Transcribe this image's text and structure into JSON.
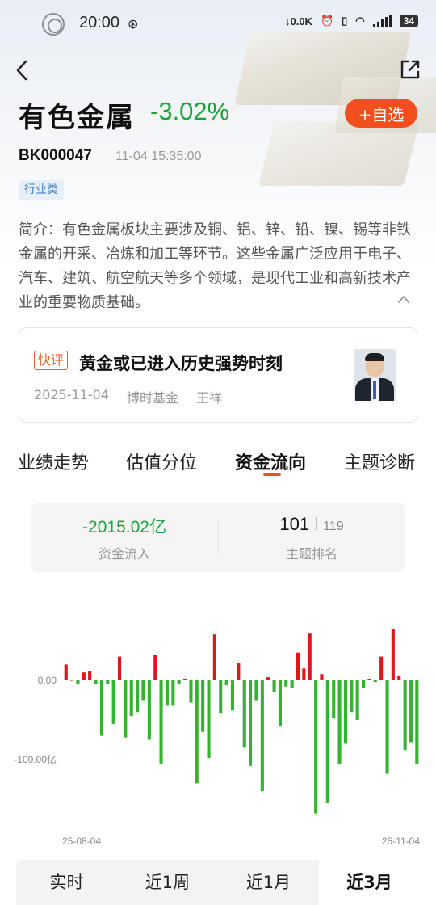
{
  "status_bar": {
    "time": "20:00",
    "net_speed": "0.0K",
    "battery": "34"
  },
  "header": {
    "title": "有色金属",
    "change": "-3.02%",
    "add_label": "+自选",
    "code": "BK000047",
    "timestamp": "11-04 15:35:00",
    "tag": "行业类"
  },
  "intro": "简介：有色金属板块主要涉及铜、铝、锌、铅、镍、锡等非铁金属的开采、冶炼和加工等环节。这些金属广泛应用于电子、汽车、建筑、航空航天等多个领域，是现代工业和高新技术产业的重要物质基础。",
  "news_card": {
    "tag": "快评",
    "title": "黄金或已进入历史强势时刻",
    "date": "2025-11-04",
    "source": "博时基金",
    "author": "王祥"
  },
  "tabs": [
    "业绩走势",
    "估值分位",
    "资金流向",
    "主题诊断"
  ],
  "active_tab": "资金流向",
  "stats": {
    "inflow_value": "-2015.02亿",
    "inflow_label": "资金流入",
    "rank": "101",
    "rank_total": "119",
    "rank_label": "主题排名"
  },
  "periods": [
    "实时",
    "近1周",
    "近1月",
    "近3月"
  ],
  "active_period": "近3月",
  "colors": {
    "positive": "#e0161c",
    "negative": "#33b32f",
    "accent": "#f24e1e"
  },
  "chart_data": {
    "type": "bar",
    "x_start_label": "25-08-04",
    "x_end_label": "25-11-04",
    "y_ticks": [
      "0.00",
      "-100.00亿"
    ],
    "ylim": [
      -170,
      60
    ],
    "values": [
      20,
      0,
      -5,
      10,
      12,
      -5,
      -70,
      -5,
      -55,
      30,
      -72,
      -45,
      -40,
      -25,
      -75,
      32,
      -105,
      -32,
      -32,
      -4,
      2,
      -28,
      -130,
      -65,
      -98,
      58,
      -42,
      -6,
      -38,
      22,
      -85,
      -108,
      -25,
      -140,
      4,
      -15,
      -58,
      -8,
      -10,
      35,
      15,
      60,
      -168,
      8,
      -155,
      -48,
      -105,
      -80,
      -40,
      -50,
      -10,
      2,
      -2,
      30,
      -118,
      65,
      6,
      -88,
      -78,
      -105
    ]
  }
}
